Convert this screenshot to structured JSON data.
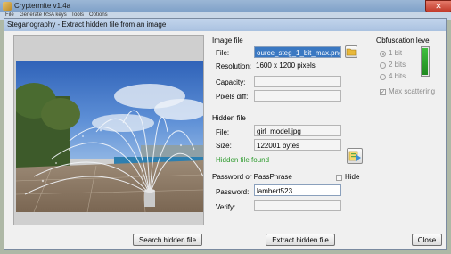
{
  "window": {
    "title": "Cryptermite v1.4a",
    "close_glyph": "✕"
  },
  "menu": {
    "items": [
      "File",
      "Generate RSA keys",
      "Tools",
      "Options"
    ]
  },
  "dialog": {
    "title": "Steganography - Extract hidden file from an image"
  },
  "image_file": {
    "section_label": "Image file",
    "file_label": "File:",
    "file_value": "ource_steg_1_bit_max.png",
    "resolution_label": "Resolution:",
    "resolution_value": "1600 x 1200 pixels",
    "capacity_label": "Capacity:",
    "capacity_value": "",
    "pixels_diff_label": "Pixels diff:",
    "pixels_diff_value": ""
  },
  "obfuscation": {
    "section_label": "Obfuscation level",
    "options": [
      "1 bit",
      "2 bits",
      "4 bits"
    ],
    "selected": "1 bit",
    "max_scattering_label": "Max scattering",
    "max_scattering_checked": true,
    "meter_level": 1.0
  },
  "hidden_file": {
    "section_label": "Hidden file",
    "file_label": "File:",
    "file_value": "girl_model.jpg",
    "size_label": "Size:",
    "size_value": "122001 bytes",
    "status_text": "Hidden file found"
  },
  "password": {
    "section_label": "Password or PassPhrase",
    "hide_label": "Hide",
    "hide_checked": false,
    "password_label": "Password:",
    "password_value": "lambert523",
    "verify_label": "Verify:",
    "verify_value": ""
  },
  "buttons": {
    "search": "Search hidden file",
    "extract": "Extract hidden file",
    "close": "Close"
  },
  "icons": {
    "browse": "folder-icon",
    "save_hidden": "save-file-icon"
  }
}
